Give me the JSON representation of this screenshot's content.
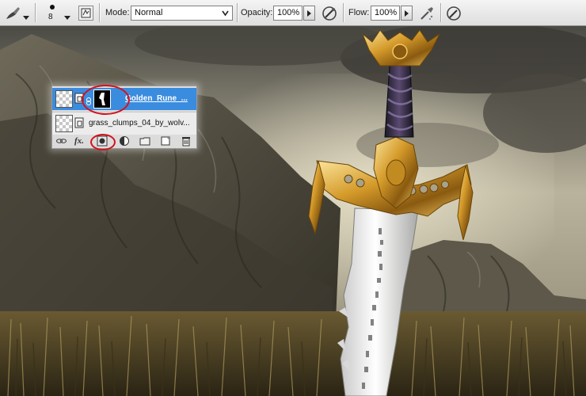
{
  "options_bar": {
    "brush_size": "8",
    "mode_label": "Mode:",
    "mode_value": "Normal",
    "opacity_label": "Opacity:",
    "opacity_value": "100%",
    "flow_label": "Flow:",
    "flow_value": "100%",
    "icons": [
      "brush-tool-icon",
      "brush-preset-icon",
      "toggle-brush-panel-icon",
      "airbrush-icon",
      "tablet-pressure-opacity-icon",
      "tablet-pressure-size-icon"
    ]
  },
  "layers_panel": {
    "layers": [
      {
        "name": "Golden_Rune_...",
        "selected": true,
        "has_mask": true
      },
      {
        "name": "grass_clumps_04_by_wolv...",
        "selected": false,
        "has_mask": false
      }
    ],
    "footer_labels": {
      "fx": "fx."
    },
    "footer_icons": [
      "link-layers-icon",
      "layer-style-icon",
      "add-layer-mask-icon",
      "adjustment-layer-icon",
      "new-group-icon",
      "new-layer-icon",
      "delete-layer-icon"
    ],
    "highlight_color": "#d6111b",
    "selection_color": "#3a8cdf"
  },
  "canvas": {
    "subject": "golden sword over rocky mountain and grass"
  }
}
